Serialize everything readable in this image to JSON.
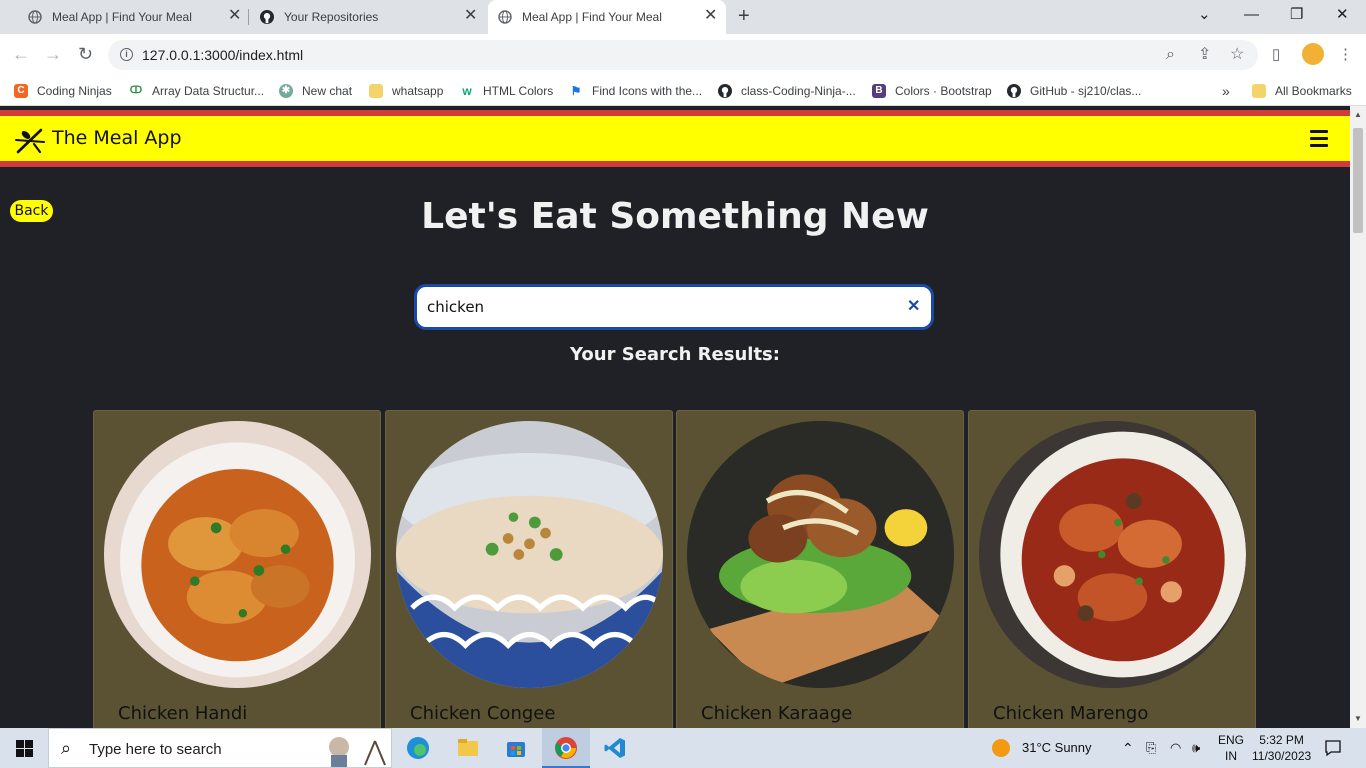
{
  "browser": {
    "tabs": [
      {
        "title": "Meal App | Find Your Meal",
        "active": false,
        "icon": "globe-icon"
      },
      {
        "title": "Your Repositories",
        "active": false,
        "icon": "github-icon"
      },
      {
        "title": "Meal App | Find Your Meal",
        "active": true,
        "icon": "globe-icon"
      }
    ],
    "url": "127.0.0.1:3000/index.html",
    "bookmarks": [
      {
        "label": "Coding Ninjas",
        "icon": "coding-ninjas-icon",
        "color": "#f26522"
      },
      {
        "label": "Array Data Structur...",
        "icon": "gfg-icon",
        "color": "#2f8d46"
      },
      {
        "label": "New chat",
        "icon": "chatgpt-icon",
        "color": "#74aa9c"
      },
      {
        "label": "whatsapp",
        "icon": "folder-icon",
        "color": "#f4d36a"
      },
      {
        "label": "HTML Colors",
        "icon": "w3-icon",
        "color": "#04aa6d"
      },
      {
        "label": "Find Icons with the...",
        "icon": "fontawesome-flag-icon",
        "color": "#1a73e8"
      },
      {
        "label": "class-Coding-Ninja-...",
        "icon": "github-icon",
        "color": "#24292f"
      },
      {
        "label": "Colors · Bootstrap",
        "icon": "bootstrap-icon",
        "color": "#563d7c"
      },
      {
        "label": "GitHub - sj210/clas...",
        "icon": "github-icon",
        "color": "#24292f"
      }
    ],
    "all_bookmarks_label": "All Bookmarks"
  },
  "app": {
    "brand": "The Meal App",
    "back_label": "Back",
    "headline": "Let's Eat Something New",
    "search": {
      "value": "chicken",
      "placeholder": ""
    },
    "results_title": "Your Search Results:",
    "meals": [
      {
        "name": "Chicken Handi"
      },
      {
        "name": "Chicken Congee"
      },
      {
        "name": "Chicken Karaage"
      },
      {
        "name": "Chicken Marengo"
      }
    ],
    "colors": {
      "navbar": "#ffff00",
      "navbar_border": "#d33a3a",
      "background": "#1f2126",
      "card": "#5a5232",
      "search_border": "#1a4aa8"
    }
  },
  "taskbar": {
    "search_placeholder": "Type here to search",
    "weather": "31°C  Sunny",
    "lang_top": "ENG",
    "lang_bottom": "IN",
    "time": "5:32 PM",
    "date": "11/30/2023"
  }
}
